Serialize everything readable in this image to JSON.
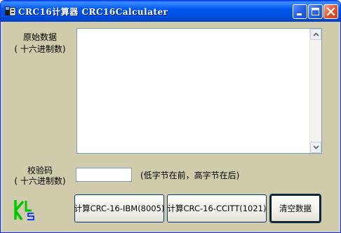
{
  "window": {
    "title": "CRC16计算器 CRC16Calculater"
  },
  "labels": {
    "raw_data": "原始数据",
    "raw_data_hint": "( 十六进制数)",
    "checksum": "校验码",
    "checksum_hint": "( 十六进制数)",
    "byte_order": "(低字节在前，高字节在后)"
  },
  "fields": {
    "raw_data_value": "",
    "checksum_value": ""
  },
  "buttons": {
    "ibm": "计算CRC-16-IBM(8005)",
    "ccitt": "计算CRC-16-CCITT(1021)",
    "clear": "清空数据"
  },
  "logo": {
    "text": "KS"
  },
  "colors": {
    "titlebar": "#0054e3",
    "client_bg": "#cfcbab",
    "logo_green": "#00c800",
    "logo_blue": "#1e3cff"
  }
}
